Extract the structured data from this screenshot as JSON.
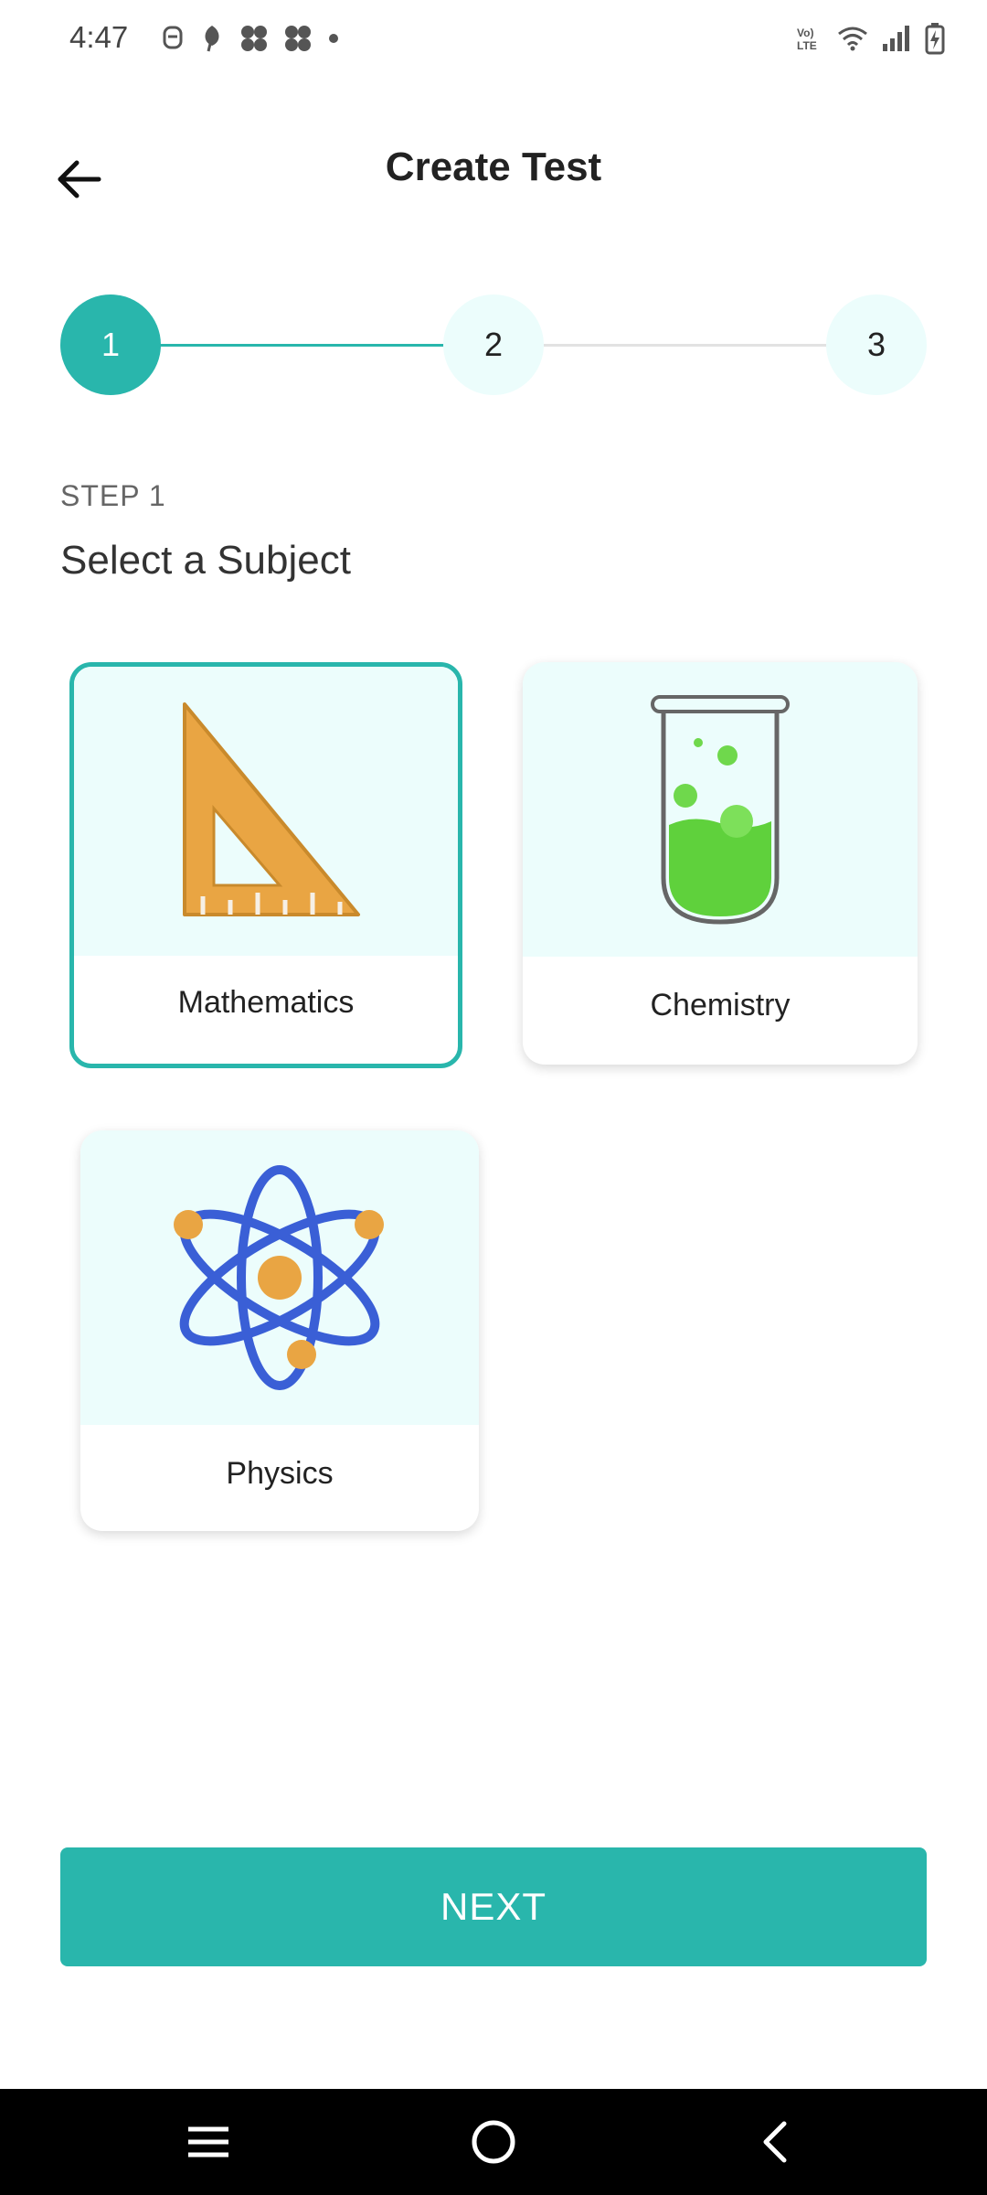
{
  "status_bar": {
    "time": "4:47",
    "left_icons": [
      "profile-icon",
      "leaf-icon",
      "pinwheel-icon",
      "pinwheel-icon",
      "dot-icon"
    ],
    "right_icons": [
      "volte-icon",
      "wifi-icon",
      "signal-icon",
      "battery-charging-icon"
    ],
    "volte_text": "Vo) LTE"
  },
  "header": {
    "title": "Create Test",
    "back_icon": "arrow-left-icon"
  },
  "stepper": {
    "steps": [
      {
        "label": "1",
        "state": "active"
      },
      {
        "label": "2",
        "state": "idle"
      },
      {
        "label": "3",
        "state": "idle"
      }
    ],
    "colors": {
      "active": "#29b6ac",
      "idle": "#ecfdfc"
    }
  },
  "step": {
    "label": "STEP 1",
    "heading": "Select a Subject"
  },
  "subjects": [
    {
      "label": "Mathematics",
      "icon": "set-square-icon",
      "selected": true
    },
    {
      "label": "Chemistry",
      "icon": "test-tube-icon",
      "selected": false
    },
    {
      "label": "Physics",
      "icon": "atom-icon",
      "selected": false
    }
  ],
  "actions": {
    "next_label": "NEXT"
  },
  "nav_bar": {
    "icons": [
      "recent-apps-icon",
      "home-icon",
      "back-icon"
    ]
  },
  "colors": {
    "accent": "#29b6ac",
    "card_bg": "#ecfdfc"
  }
}
